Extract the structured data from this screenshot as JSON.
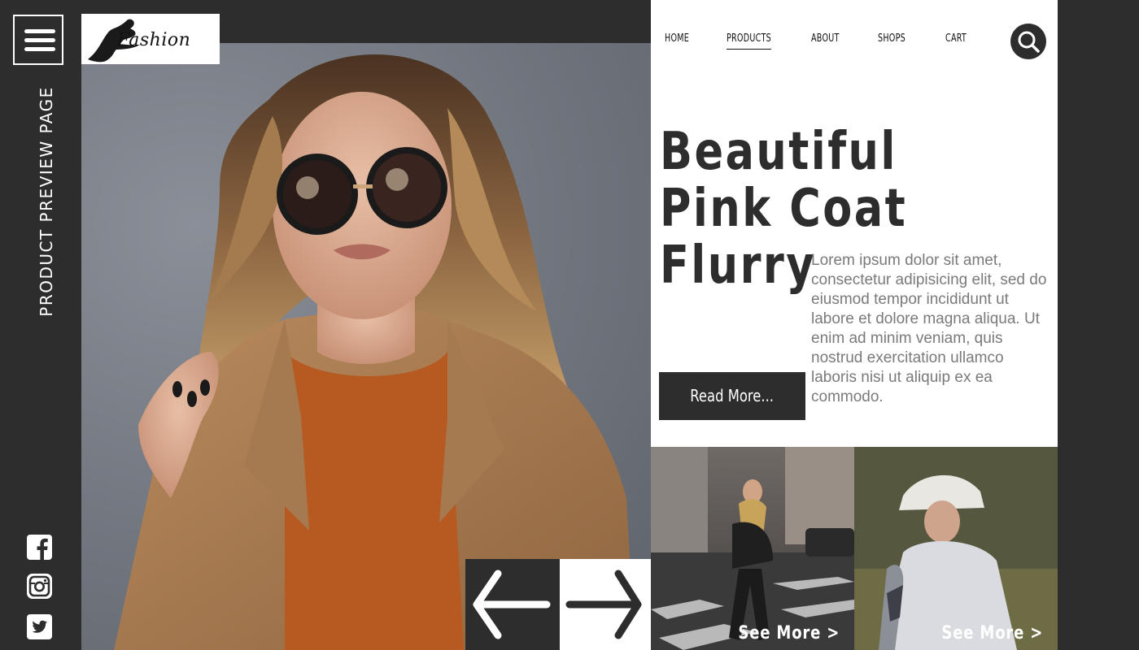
{
  "sidebar": {
    "page_label": "PRODUCT PREVIEW PAGE",
    "social": [
      "facebook-icon",
      "instagram-icon",
      "twitter-icon"
    ]
  },
  "brand": {
    "logo_text": "Fashion"
  },
  "nav": {
    "items": [
      {
        "label": "HOME",
        "active": false
      },
      {
        "label": "PRODUCTS",
        "active": true
      },
      {
        "label": "ABOUT",
        "active": false
      },
      {
        "label": "SHOPS",
        "active": false
      },
      {
        "label": "CART",
        "active": false
      }
    ],
    "search_icon": "search-icon"
  },
  "hero": {
    "title_lines": [
      "Beautiful",
      "Pink Coat",
      "Flurry"
    ],
    "description": "Lorem ipsum dolor sit amet, consectetur adipisicing elit, sed do eiusmod tempor incididunt ut labore et dolore magna aliqua. Ut enim ad minim veniam, quis nostrud exercitation ullamco laboris nisi ut aliquip ex ea commodo.",
    "cta_label": "Read More..."
  },
  "carousel": {
    "prev_icon": "arrow-left-icon",
    "next_icon": "arrow-right-icon"
  },
  "thumbnails": [
    {
      "cta_label": "See More >"
    },
    {
      "cta_label": "See More >"
    }
  ],
  "colors": {
    "dark": "#2d2d2d",
    "panel": "#ffffff",
    "body_text": "#7a7a7a"
  }
}
